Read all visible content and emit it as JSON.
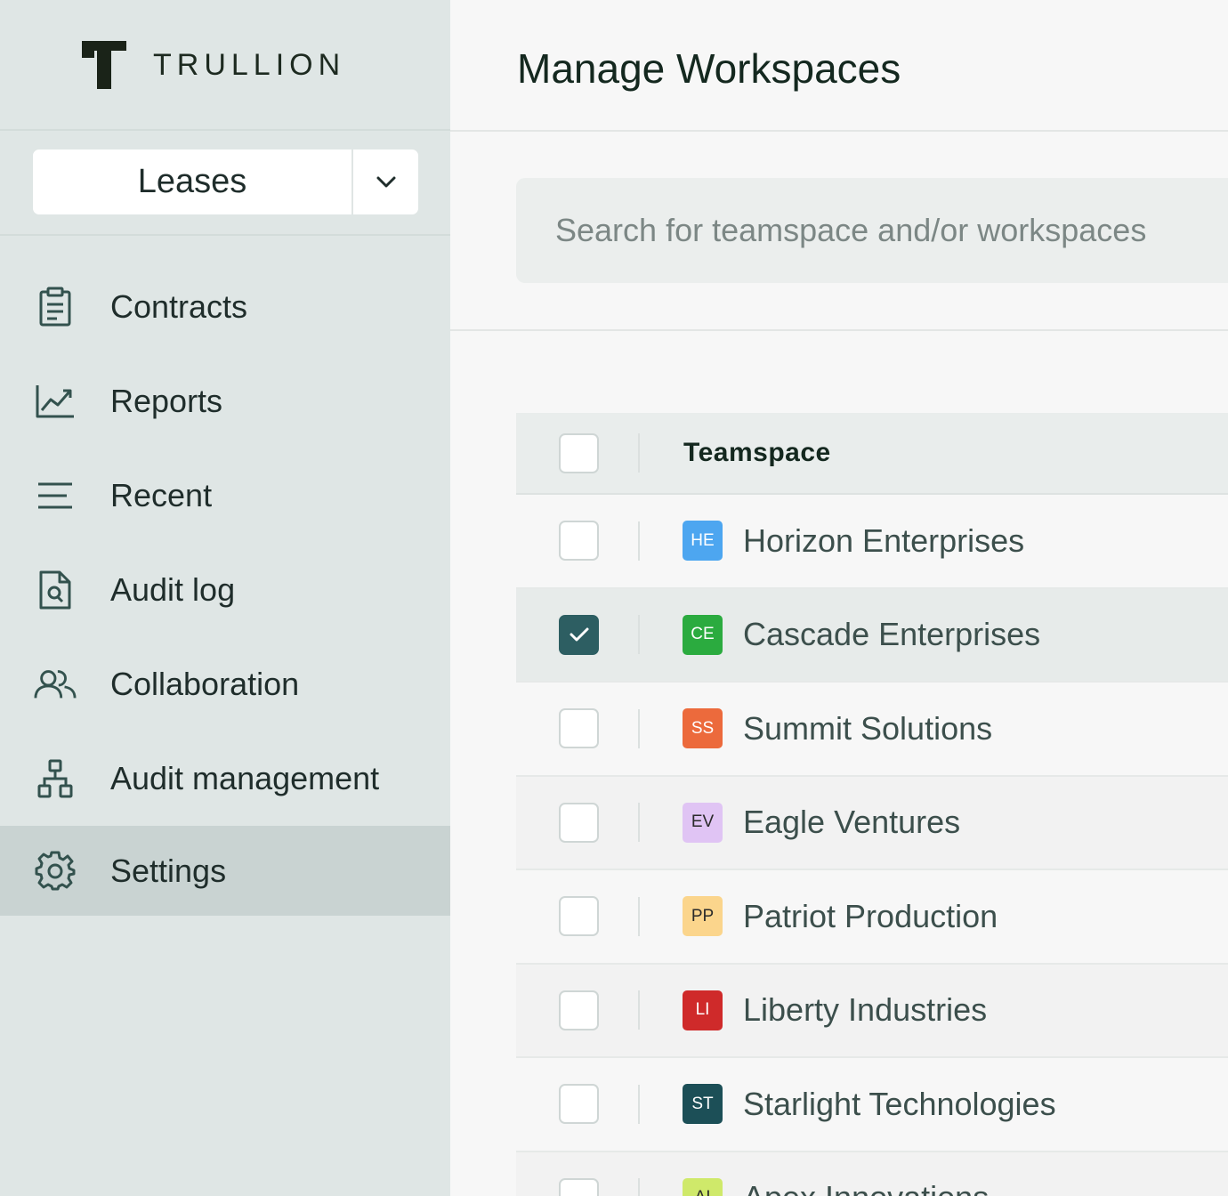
{
  "brand": {
    "name": "TRULLION"
  },
  "workspace_selector": {
    "value": "Leases"
  },
  "nav": {
    "items": [
      {
        "label": "Contracts",
        "icon": "clipboard-icon",
        "active": false
      },
      {
        "label": "Reports",
        "icon": "chart-line-icon",
        "active": false
      },
      {
        "label": "Recent",
        "icon": "lines-icon",
        "active": false
      },
      {
        "label": "Audit log",
        "icon": "document-search-icon",
        "active": false
      },
      {
        "label": "Collaboration",
        "icon": "users-icon",
        "active": false
      },
      {
        "label": "Audit management",
        "icon": "hierarchy-icon",
        "active": false
      },
      {
        "label": "Settings",
        "icon": "gear-icon",
        "active": true
      }
    ]
  },
  "page": {
    "title": "Manage Workspaces"
  },
  "search": {
    "placeholder": "Search for teamspace and/or workspaces"
  },
  "table": {
    "header": "Teamspace",
    "rows": [
      {
        "initials": "HE",
        "name": "Horizon Enterprises",
        "color": "#4da6f0",
        "initials_color": "#ffffff",
        "checked": false
      },
      {
        "initials": "CE",
        "name": "Cascade Enterprises",
        "color": "#2bab3f",
        "initials_color": "#ffffff",
        "checked": true
      },
      {
        "initials": "SS",
        "name": "Summit Solutions",
        "color": "#ec6a3c",
        "initials_color": "#ffffff",
        "checked": false
      },
      {
        "initials": "EV",
        "name": "Eagle Ventures",
        "color": "#e0c4f4",
        "initials_color": "#2a2a2a",
        "checked": false
      },
      {
        "initials": "PP",
        "name": "Patriot Production",
        "color": "#fbd58c",
        "initials_color": "#2a2a2a",
        "checked": false
      },
      {
        "initials": "LI",
        "name": "Liberty Industries",
        "color": "#cf2a2a",
        "initials_color": "#ffffff",
        "checked": false
      },
      {
        "initials": "ST",
        "name": "Starlight Technologies",
        "color": "#1c4f57",
        "initials_color": "#ffffff",
        "checked": false
      },
      {
        "initials": "AI",
        "name": "Apex Innovations",
        "color": "#cfe96a",
        "initials_color": "#2a2a2a",
        "checked": false
      }
    ]
  }
}
